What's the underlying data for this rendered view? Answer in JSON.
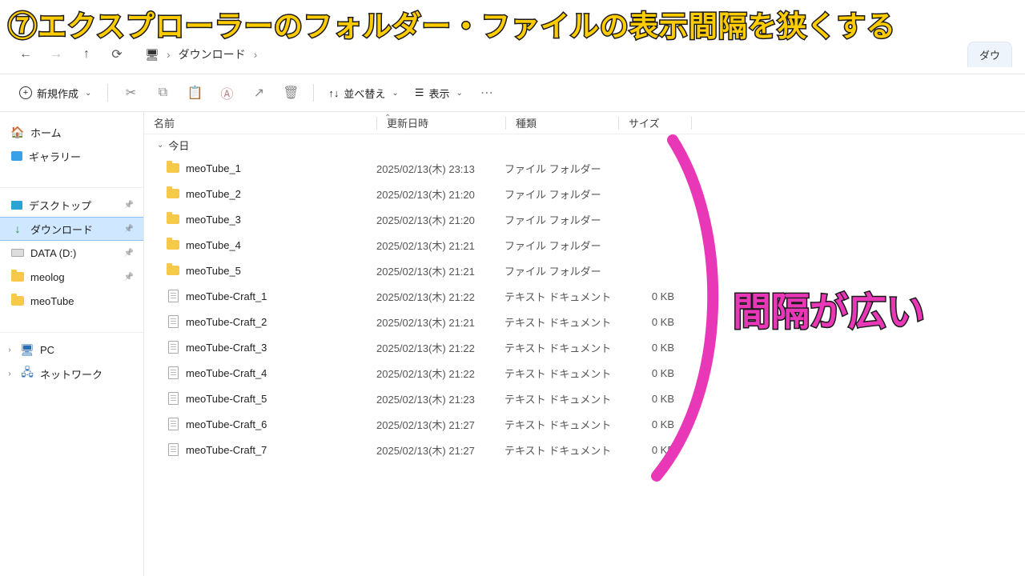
{
  "overlay": {
    "title": "⑦エクスプローラーのフォルダー・ファイルの表示間隔を狭くする",
    "side": "間隔が広い"
  },
  "nav": {
    "crumb1": "ダウンロード",
    "right_tab": "ダウ"
  },
  "toolbar": {
    "new_label": "新規作成",
    "sort_label": "並べ替え",
    "view_label": "表示"
  },
  "sidebar": {
    "home": "ホーム",
    "gallery": "ギャラリー",
    "desktop": "デスクトップ",
    "downloads": "ダウンロード",
    "data_d": "DATA (D:)",
    "meolog": "meolog",
    "meotube": "meoTube",
    "pc": "PC",
    "network": "ネットワーク"
  },
  "columns": {
    "name": "名前",
    "date": "更新日時",
    "type": "種類",
    "size": "サイズ"
  },
  "group": "今日",
  "rows": [
    {
      "icon": "folder",
      "name": "meoTube_1",
      "date": "2025/02/13(木) 23:13",
      "type": "ファイル フォルダー",
      "size": ""
    },
    {
      "icon": "folder",
      "name": "meoTube_2",
      "date": "2025/02/13(木) 21:20",
      "type": "ファイル フォルダー",
      "size": ""
    },
    {
      "icon": "folder",
      "name": "meoTube_3",
      "date": "2025/02/13(木) 21:20",
      "type": "ファイル フォルダー",
      "size": ""
    },
    {
      "icon": "folder",
      "name": "meoTube_4",
      "date": "2025/02/13(木) 21:21",
      "type": "ファイル フォルダー",
      "size": ""
    },
    {
      "icon": "folder",
      "name": "meoTube_5",
      "date": "2025/02/13(木) 21:21",
      "type": "ファイル フォルダー",
      "size": ""
    },
    {
      "icon": "file",
      "name": "meoTube-Craft_1",
      "date": "2025/02/13(木) 21:22",
      "type": "テキスト ドキュメント",
      "size": "0 KB"
    },
    {
      "icon": "file",
      "name": "meoTube-Craft_2",
      "date": "2025/02/13(木) 21:21",
      "type": "テキスト ドキュメント",
      "size": "0 KB"
    },
    {
      "icon": "file",
      "name": "meoTube-Craft_3",
      "date": "2025/02/13(木) 21:22",
      "type": "テキスト ドキュメント",
      "size": "0 KB"
    },
    {
      "icon": "file",
      "name": "meoTube-Craft_4",
      "date": "2025/02/13(木) 21:22",
      "type": "テキスト ドキュメント",
      "size": "0 KB"
    },
    {
      "icon": "file",
      "name": "meoTube-Craft_5",
      "date": "2025/02/13(木) 21:23",
      "type": "テキスト ドキュメント",
      "size": "0 KB"
    },
    {
      "icon": "file",
      "name": "meoTube-Craft_6",
      "date": "2025/02/13(木) 21:27",
      "type": "テキスト ドキュメント",
      "size": "0 KB"
    },
    {
      "icon": "file",
      "name": "meoTube-Craft_7",
      "date": "2025/02/13(木) 21:27",
      "type": "テキスト ドキュメント",
      "size": "0 KB"
    }
  ]
}
